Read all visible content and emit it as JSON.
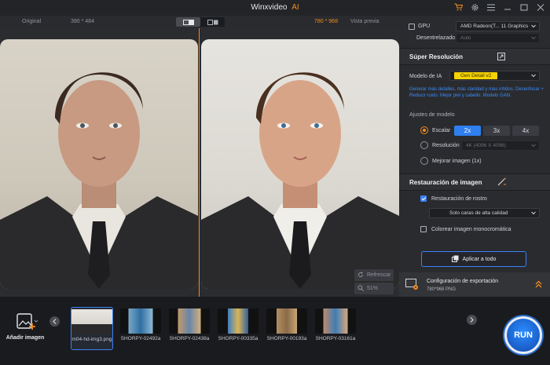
{
  "app": {
    "title": "Winxvideo",
    "title_suffix": "AI"
  },
  "compare": {
    "original_label": "Original",
    "original_res": "390 * 484",
    "output_res": "780 * 968",
    "preview_label": "Vista previa"
  },
  "preview_controls": {
    "refresh_label": "Refrescar",
    "zoom": "51%"
  },
  "gpu": {
    "label": "GPU",
    "device": "AMD Radeon(T... 11 Graphics",
    "deinterlace_label": "Desentrelazado",
    "deinterlace_value": "Auto"
  },
  "super_resolution": {
    "title": "Súper Resolución",
    "model_label": "Modelo de IA",
    "model_value": "Gen Detail v2",
    "description": "Generar más detalles, más claridad y más nítidos. Desenfocar + Reducir ruido. Mejor piel y cabello. Modelo GAN.",
    "settings_label": "Ajustes de modelo",
    "scale_label": "Escalar",
    "scale_options": [
      "2x",
      "3x",
      "4x"
    ],
    "resolution_label": "Resolución",
    "resolution_value": "4K (4096 X 4096)",
    "enhance_label": "Mejorar imagen (1x)"
  },
  "restoration": {
    "title": "Restauración de imagen",
    "face_label": "Restauración de rostro",
    "face_mode": "Solo caras de alta calidad",
    "colorize_label": "Colorear imagen monocromática"
  },
  "apply_all_label": "Aplicar a todo",
  "export": {
    "title": "Configuración de exportación",
    "info": "780*968  PNG"
  },
  "media": {
    "add_label": "Añadir imagen",
    "thumbnails": [
      {
        "name": "m04-hd-img3.png"
      },
      {
        "name": "SHORPY-02492a"
      },
      {
        "name": "SHORPY-02438a"
      },
      {
        "name": "SHORPY-00335a"
      },
      {
        "name": "SHORPY-00193a"
      },
      {
        "name": "SHORPY-03161a"
      }
    ]
  },
  "run_label": "RUN",
  "colors": {
    "accent": "#f08c1e",
    "primary": "#2f7ff0",
    "highlight": "#f5d300"
  }
}
